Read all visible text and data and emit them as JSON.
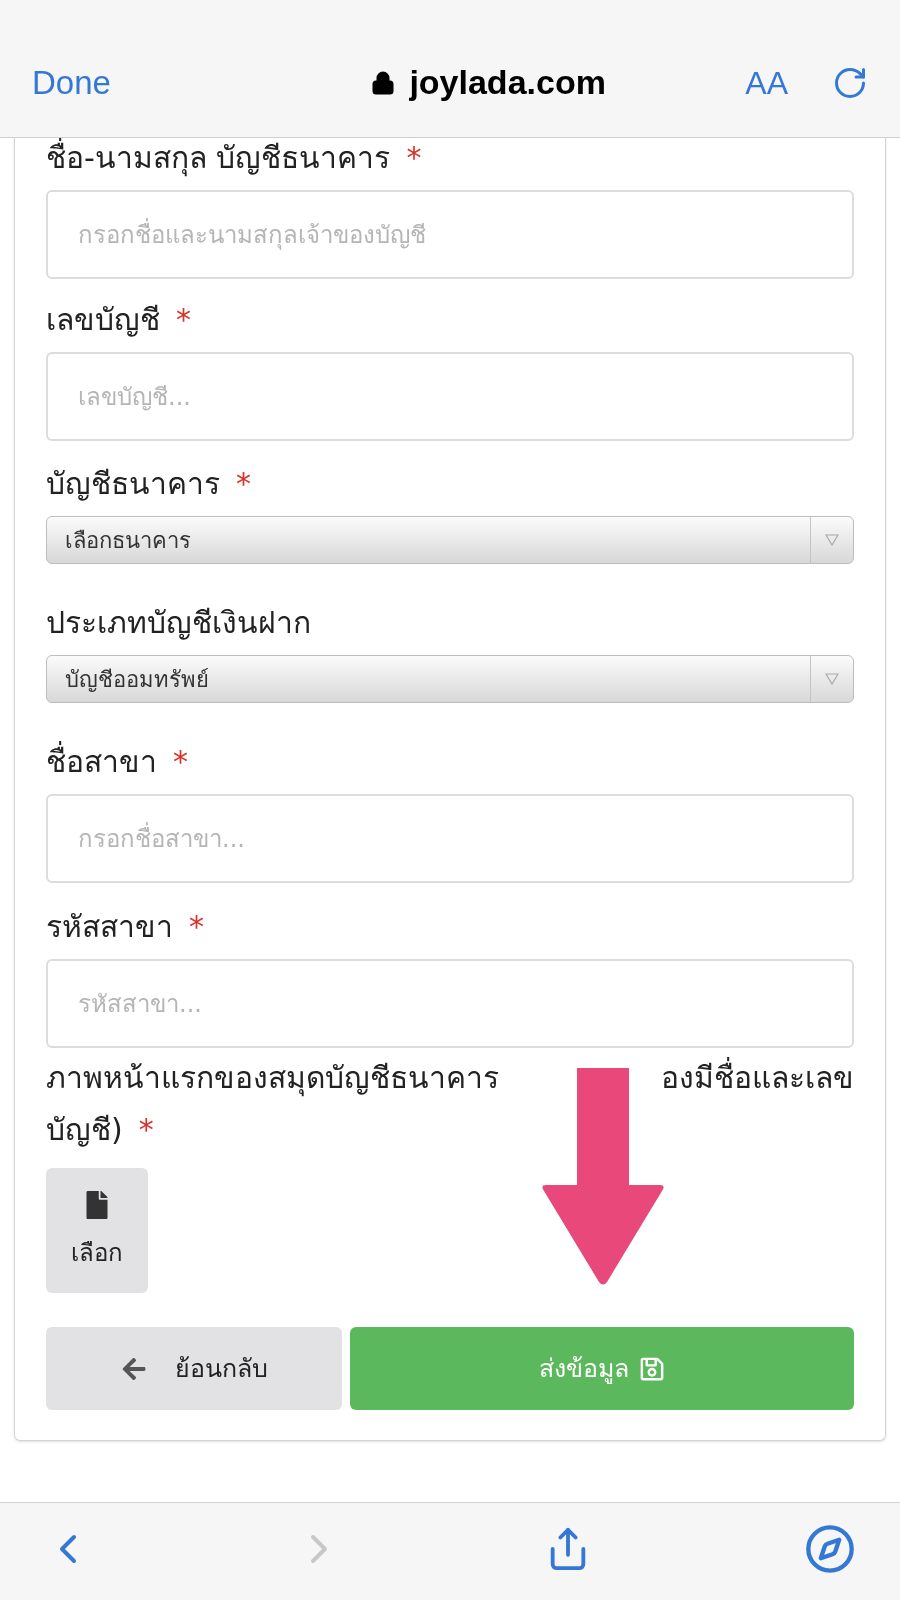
{
  "browser": {
    "done": "Done",
    "domain": "joylada.com",
    "text_size": "AA"
  },
  "form": {
    "fields": [
      {
        "kind": "input",
        "label": "ชื่อ-นามสกุล บัญชีธนาคาร",
        "required_mark": "*",
        "placeholder": "กรอกชื่อและนามสกุลเจ้าของบัญชี"
      },
      {
        "kind": "input",
        "label": "เลขบัญชี",
        "required_mark": "*",
        "placeholder": "เลขบัญชี..."
      },
      {
        "kind": "select",
        "label": "บัญชีธนาคาร",
        "required_mark": "*",
        "value": "เลือกธนาคาร"
      },
      {
        "kind": "select",
        "label": "ประเภทบัญชีเงินฝาก",
        "value": "บัญชีออมทรัพย์"
      },
      {
        "kind": "input",
        "label": "ชื่อสาขา",
        "required_mark": "*",
        "placeholder": "กรอกชื่อสาขา..."
      },
      {
        "kind": "input",
        "label": "รหัสสาขา",
        "required_mark": "*",
        "placeholder": "รหัสสาขา..."
      },
      {
        "kind": "file",
        "label": "ภาพหน้าแรกของสมุดบัญชีธนาคาร",
        "label_after_arrow": "องมีชื่อและเลข",
        "label_second_line": "บัญชี)",
        "required_mark": "*",
        "button": "เลือก"
      }
    ],
    "back_button": "ย้อนกลับ",
    "submit_button": "ส่งข้อมูล"
  },
  "toolbar": {
    "back_disabled": false,
    "forward_disabled": true
  }
}
